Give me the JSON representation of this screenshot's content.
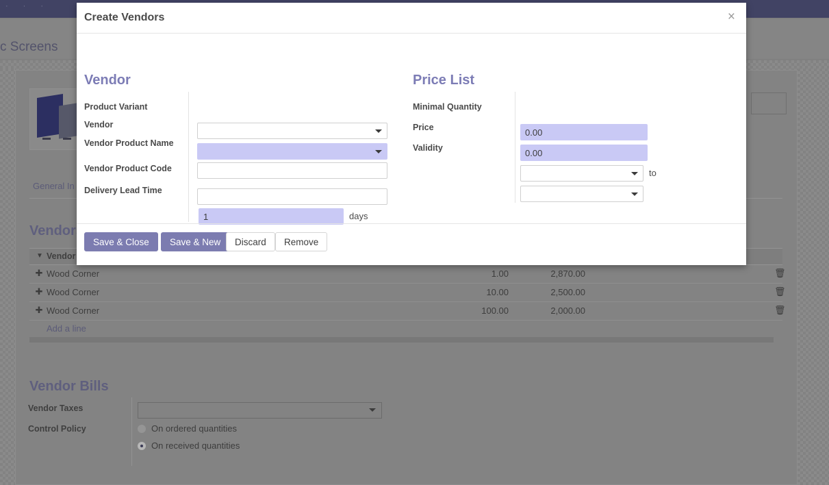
{
  "background": {
    "breadcrumb_text": "c Screens",
    "tab_label": "General In",
    "product_image_alt": "acoustic-screen-panels",
    "vendors": {
      "section_title": "Vendors",
      "column_header": "Vendor",
      "add_line_label": "Add a line",
      "rows": [
        {
          "vendor": "Wood Corner",
          "quantity": "1.00",
          "price": "2,870.00"
        },
        {
          "vendor": "Wood Corner",
          "quantity": "10.00",
          "price": "2,500.00"
        },
        {
          "vendor": "Wood Corner",
          "quantity": "100.00",
          "price": "2,000.00"
        }
      ]
    },
    "vendor_bills": {
      "section_title": "Vendor Bills",
      "vendor_taxes_label": "Vendor Taxes",
      "vendor_taxes_value": "",
      "control_policy_label": "Control Policy",
      "control_policy_options": [
        {
          "label": "On ordered quantities",
          "selected": false
        },
        {
          "label": "On received quantities",
          "selected": true
        }
      ]
    }
  },
  "modal": {
    "title": "Create Vendors",
    "close_label": "×",
    "vendor_group": {
      "title": "Vendor",
      "fields": {
        "product_variant_label": "Product Variant",
        "product_variant_value": "",
        "vendor_label": "Vendor",
        "vendor_value": "",
        "vendor_product_name_label": "Vendor Product Name",
        "vendor_product_name_value": "",
        "vendor_product_code_label": "Vendor Product Code",
        "vendor_product_code_value": "",
        "delivery_lead_time_label": "Delivery Lead Time",
        "delivery_lead_time_value": "1",
        "delivery_lead_time_unit": "days"
      }
    },
    "price_list_group": {
      "title": "Price List",
      "fields": {
        "minimal_quantity_label": "Minimal Quantity",
        "minimal_quantity_value": "0.00",
        "price_label": "Price",
        "price_value": "0.00",
        "validity_label": "Validity",
        "validity_from_value": "",
        "validity_to_value": "",
        "validity_separator": "to"
      }
    },
    "buttons": {
      "save_close": "Save & Close",
      "save_new": "Save & New",
      "discard": "Discard",
      "remove": "Remove"
    }
  },
  "colors": {
    "navbar": "#414364",
    "accent": "#7c7cb5",
    "primary_button": "#7c7cb0",
    "field_highlight": "#c9c9f5"
  }
}
